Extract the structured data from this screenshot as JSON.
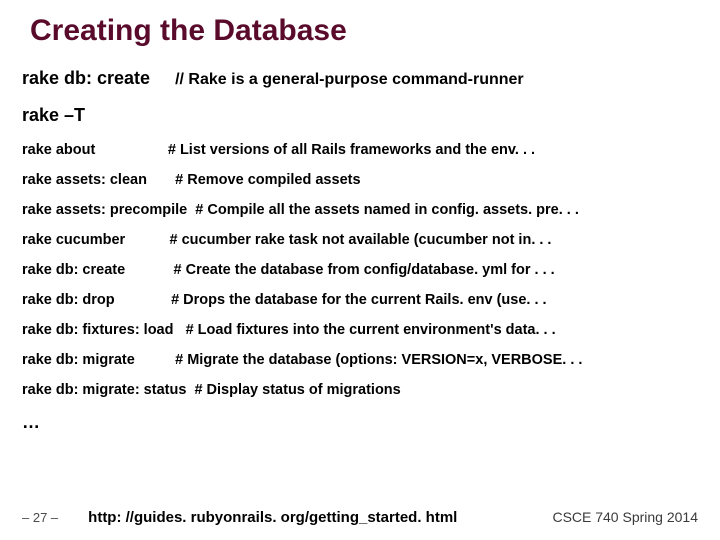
{
  "title": "Creating the Database",
  "intro": {
    "cmd": "rake db: create",
    "comment": "// Rake is a general-purpose command-runner"
  },
  "flag": "rake –T",
  "tasks": [
    {
      "cmd": "rake about",
      "desc": "# List versions of all Rails frameworks and the env. . ."
    },
    {
      "cmd": "rake assets: clean",
      "desc": "# Remove compiled assets"
    },
    {
      "cmd": "rake assets: precompile",
      "desc": "# Compile all the assets named in config. assets. pre. . ."
    },
    {
      "cmd": "rake cucumber",
      "desc": "# cucumber rake task not available (cucumber not in. . ."
    },
    {
      "cmd": "rake db: create",
      "desc": "# Create the database from config/database. yml for . . ."
    },
    {
      "cmd": "rake db: drop",
      "desc": "# Drops the database for the current Rails. env (use. . ."
    },
    {
      "cmd": "rake db: fixtures: load",
      "desc": "# Load fixtures into the current environment's data. . ."
    },
    {
      "cmd": "rake db: migrate",
      "desc": "# Migrate the database (options: VERSION=x, VERBOSE. . ."
    },
    {
      "cmd": "rake db: migrate: status",
      "desc": "# Display status of migrations"
    }
  ],
  "ellipsis": "…",
  "footer": {
    "page": "– 27 –",
    "url": "http: //guides. rubyonrails. org/getting_started. html",
    "course": "CSCE 740 Spring 2014"
  }
}
